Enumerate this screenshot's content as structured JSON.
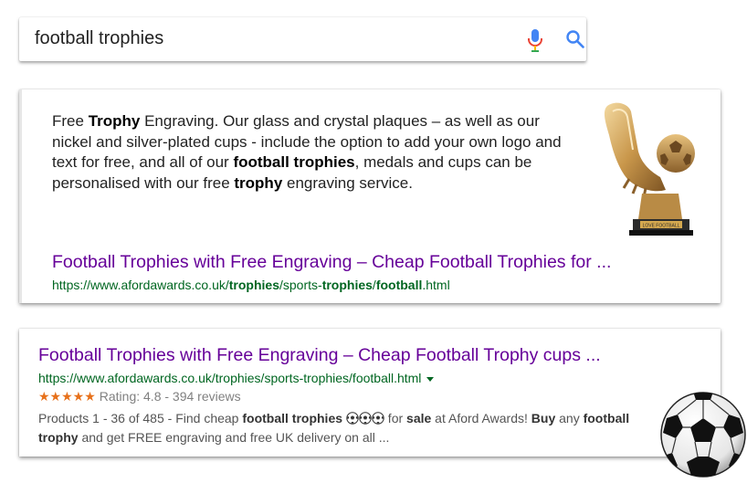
{
  "search": {
    "query": "football trophies",
    "mic_icon": "microphone-icon",
    "search_icon": "magnifier-icon",
    "accent_blue": "#4285f4"
  },
  "featured_snippet": {
    "text_parts": [
      {
        "t": "Free ",
        "b": false
      },
      {
        "t": "Trophy",
        "b": true
      },
      {
        "t": " Engraving. Our glass and crystal plaques – as well as our nickel and silver-plated cups - include the option to add your own logo and text for free, and all of our ",
        "b": false
      },
      {
        "t": "football trophies",
        "b": true
      },
      {
        "t": ", medals and cups can be personalised with our free ",
        "b": false
      },
      {
        "t": "trophy",
        "b": true
      },
      {
        "t": " engraving service.",
        "b": false
      }
    ],
    "image": "golden-boot-trophy",
    "trophy_plaque_text": "LOVE FOOTBALL",
    "title": "Football Trophies with Free Engraving – Cheap Football Trophies for ...",
    "url_parts": [
      {
        "t": "https://www.afordawards.co.uk/",
        "b": false
      },
      {
        "t": "trophies",
        "b": true
      },
      {
        "t": "/sports-",
        "b": false
      },
      {
        "t": "trophies",
        "b": true
      },
      {
        "t": "/",
        "b": false
      },
      {
        "t": "football",
        "b": true
      },
      {
        "t": ".html",
        "b": false
      }
    ]
  },
  "organic_result": {
    "title": "Football Trophies with Free Engraving – Cheap Football Trophy cups ...",
    "url": "https://www.afordawards.co.uk/trophies/sports-trophies/football.html",
    "stars": "★★★★★",
    "rating_text": "Rating: 4.8 - 394 reviews",
    "star_color": "#e7711b",
    "desc_before": [
      {
        "t": "Products 1 - 36 of 485 - Find cheap ",
        "b": false
      },
      {
        "t": "football trophies",
        "b": true
      },
      {
        "t": " ",
        "b": false
      }
    ],
    "desc_after": [
      {
        "t": " for ",
        "b": false
      },
      {
        "t": "sale",
        "b": true
      },
      {
        "t": " at Aford Awards! ",
        "b": false
      },
      {
        "t": "Buy",
        "b": true
      },
      {
        "t": " any ",
        "b": false
      },
      {
        "t": "football trophy",
        "b": true
      },
      {
        "t": " and get FREE engraving and free UK delivery on all ...",
        "b": false
      }
    ],
    "ball_emoji_count": 3
  },
  "decoration": {
    "soccer_ball": "soccer-ball-icon"
  },
  "colors": {
    "title_visited": "#660099",
    "url_green": "#006621",
    "snippet_text": "#222222",
    "desc_text": "#545454"
  }
}
